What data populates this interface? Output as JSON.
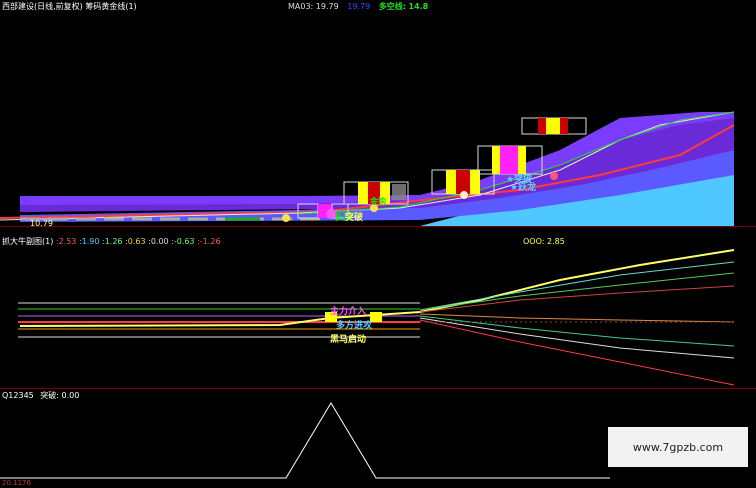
{
  "main_panel": {
    "title": "西部建设(日线,前复权) 筹码黄金线(1)",
    "ma03_label": "MA03:",
    "ma03_value": "19.79",
    "ma_blue_value": "19.79",
    "duokong_label": "多空线:",
    "duokong_value": "14.81",
    "price_marker": "10.79",
    "signals": [
      "长阳",
      "突破",
      "跃龙",
      "金钩",
      "★突破",
      "★跃龙"
    ]
  },
  "osc_panel": {
    "title": "抓大牛副图(1)",
    "values": [
      ":2.53",
      ":1.90",
      ":1.26",
      ":0.63",
      ":0.00",
      ":-0.63",
      ":-1.26"
    ],
    "right_value": "OOO: 2.85",
    "signals": [
      "主力介入",
      "多方进攻",
      "黑马启动"
    ]
  },
  "bottom_panel": {
    "title": "Q12345",
    "break_label": "突破:",
    "break_value": "0.00",
    "axis_label": "20.1176"
  },
  "watermark": "www.7gpzb.com",
  "colors": {
    "background": "#000000",
    "separator": "#7a0000",
    "ma_red": "#ff3b3b",
    "ma_blue": "#3b3bff",
    "duokong_green": "#22dd22",
    "band_purple": "#7a3cff",
    "band_cyan": "#4fc8ff",
    "chip_yellow": "#ffff00",
    "chip_magenta": "#ff22ff"
  }
}
